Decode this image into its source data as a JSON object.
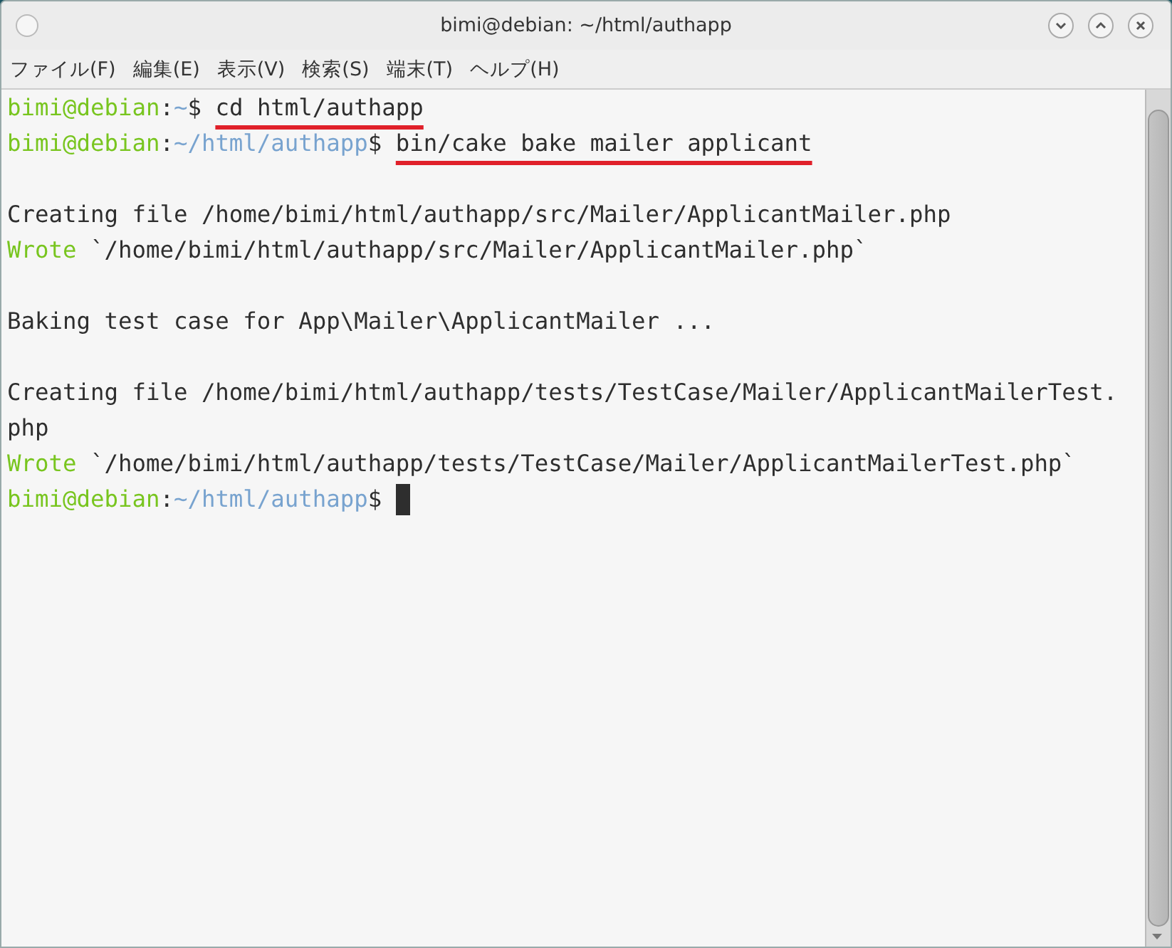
{
  "window": {
    "title": "bimi@debian: ~/html/authapp"
  },
  "menu": [
    "ファイル(F)",
    "編集(E)",
    "表示(V)",
    "検索(S)",
    "端末(T)",
    "ヘルプ(H)"
  ],
  "terminal": {
    "lines": [
      {
        "segments": [
          {
            "kind": "user",
            "text": "bimi@debian"
          },
          {
            "kind": "plain",
            "text": ":"
          },
          {
            "kind": "path",
            "text": "~"
          },
          {
            "kind": "plain",
            "text": "$ "
          },
          {
            "kind": "plain",
            "text": "cd html/authapp",
            "underlined": true
          }
        ]
      },
      {
        "segments": [
          {
            "kind": "user",
            "text": "bimi@debian"
          },
          {
            "kind": "plain",
            "text": ":"
          },
          {
            "kind": "path",
            "text": "~/html/authapp"
          },
          {
            "kind": "plain",
            "text": "$ "
          },
          {
            "kind": "plain",
            "text": "bin/cake bake mailer applicant",
            "underlined": true
          }
        ]
      },
      {
        "gap_before": true,
        "segments": [
          {
            "kind": "plain",
            "text": "Creating file /home/bimi/html/authapp/src/Mailer/ApplicantMailer.php"
          }
        ]
      },
      {
        "segments": [
          {
            "kind": "user",
            "text": "Wrote"
          },
          {
            "kind": "plain",
            "text": " `/home/bimi/html/authapp/src/Mailer/ApplicantMailer.php`"
          }
        ]
      },
      {
        "gap_before": true,
        "segments": [
          {
            "kind": "plain",
            "text": "Baking test case for App\\Mailer\\ApplicantMailer ..."
          }
        ]
      },
      {
        "gap_before": true,
        "segments": [
          {
            "kind": "plain",
            "text": "Creating file /home/bimi/html/authapp/tests/TestCase/Mailer/ApplicantMailerTest."
          }
        ]
      },
      {
        "segments": [
          {
            "kind": "plain",
            "text": "php"
          }
        ]
      },
      {
        "segments": [
          {
            "kind": "user",
            "text": "Wrote"
          },
          {
            "kind": "plain",
            "text": " `/home/bimi/html/authapp/tests/TestCase/Mailer/ApplicantMailerTest.php`"
          }
        ]
      },
      {
        "cursor": true,
        "segments": [
          {
            "kind": "user",
            "text": "bimi@debian"
          },
          {
            "kind": "plain",
            "text": ":"
          },
          {
            "kind": "path",
            "text": "~/html/authapp"
          },
          {
            "kind": "plain",
            "text": "$ "
          }
        ]
      }
    ]
  }
}
